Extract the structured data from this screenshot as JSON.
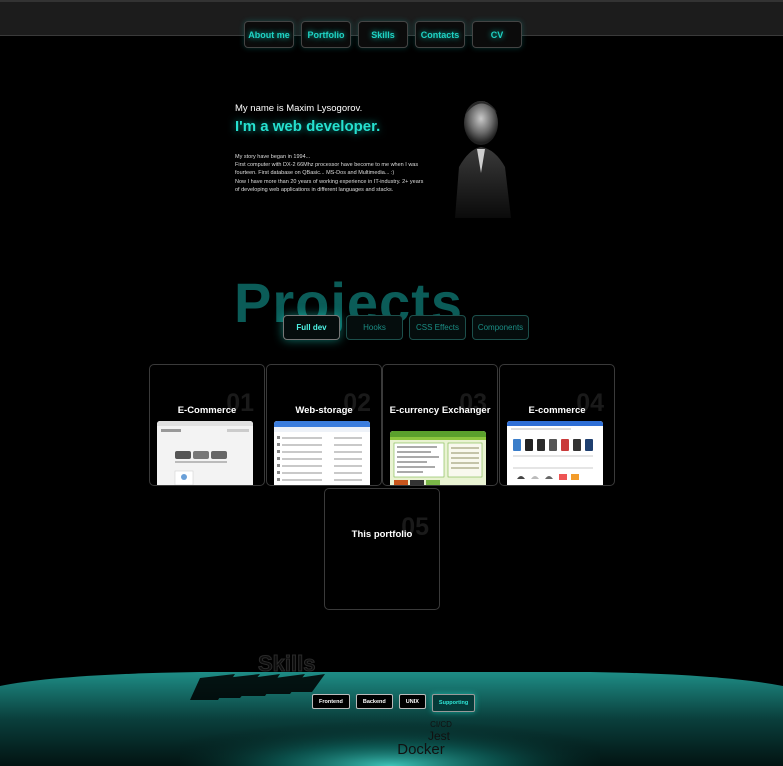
{
  "nav": {
    "items": [
      "About me",
      "Portfolio",
      "Skills",
      "Contacts",
      "CV"
    ]
  },
  "intro": {
    "name": "My name is Maxim Lysogorov.",
    "role": "I'm a web developer.",
    "story": [
      "My story have began in 1994...",
      "First computer with DX-2 66Mhz processor have become to me when I was fourteen. First database on QBasic... MS-Dos and Multimedia... :)",
      "Now I have more than 20 years of working experience in IT-industry. 2+ years of developing web applications in different languages and stacks."
    ]
  },
  "projects": {
    "title": "Projects",
    "filters": [
      {
        "label": "Full dev",
        "active": true
      },
      {
        "label": "Hooks",
        "active": false
      },
      {
        "label": "CSS Effects",
        "active": false
      },
      {
        "label": "Components",
        "active": false
      }
    ],
    "cards": [
      {
        "num": "01",
        "title": "E-Commerce"
      },
      {
        "num": "02",
        "title": "Web-storage"
      },
      {
        "num": "03",
        "title": "E-currency Exchanger"
      },
      {
        "num": "04",
        "title": "E-commerce"
      },
      {
        "num": "05",
        "title": "This portfolio"
      }
    ]
  },
  "skills": {
    "title": "Skills",
    "tabs": [
      {
        "label": "Frontend",
        "active": false
      },
      {
        "label": "Backend",
        "active": false
      },
      {
        "label": "UNIX",
        "active": false
      },
      {
        "label": "Supporting",
        "active": true
      }
    ],
    "items": [
      "CI/CD",
      "Jest",
      "Docker"
    ]
  },
  "colors": {
    "accent": "#26e0cf",
    "accent_dark": "#0b5c58",
    "background": "#000000"
  }
}
